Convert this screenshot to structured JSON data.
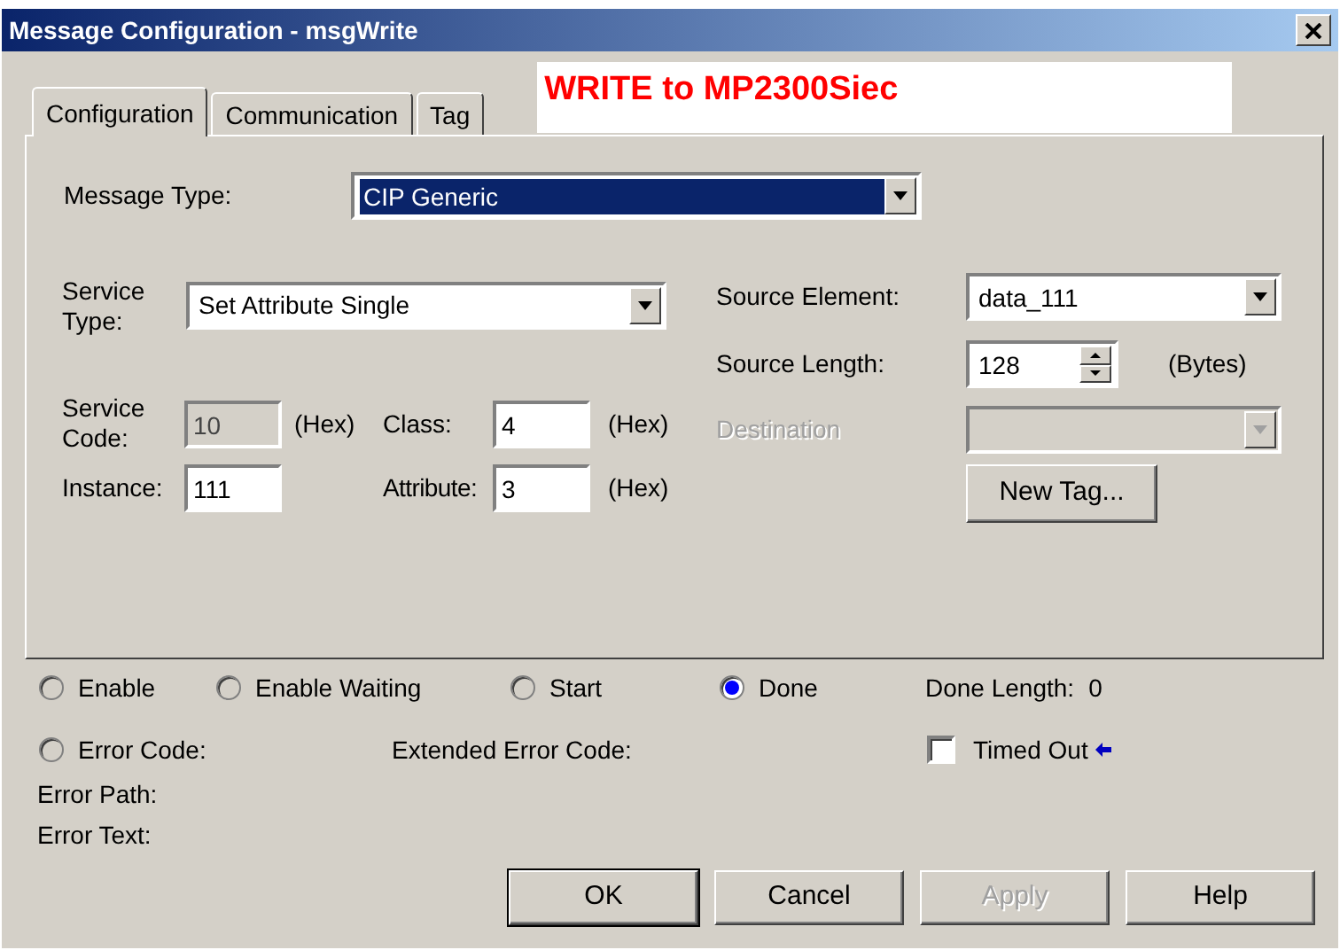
{
  "window": {
    "title": "Message Configuration - msgWrite"
  },
  "tabs": [
    {
      "label": "Configuration",
      "selected": true
    },
    {
      "label": "Communication",
      "selected": false
    },
    {
      "label": "Tag",
      "selected": false
    }
  ],
  "banner": "WRITE to MP2300Siec",
  "message_type": {
    "label": "Message Type:",
    "value": "CIP Generic"
  },
  "service_type": {
    "label": "Service Type:",
    "value": "Set Attribute Single"
  },
  "service_code": {
    "label": "Service Code:",
    "value": "10",
    "unit": "(Hex)",
    "disabled": true
  },
  "class": {
    "label": "Class:",
    "value": "4",
    "unit": "(Hex)"
  },
  "instance": {
    "label": "Instance:",
    "value": "111"
  },
  "attribute": {
    "label": "Attribute:",
    "value": "3",
    "unit": "(Hex)"
  },
  "source_element": {
    "label": "Source Element:",
    "value": "data_111"
  },
  "source_length": {
    "label": "Source Length:",
    "value": "128",
    "unit": "(Bytes)"
  },
  "destination": {
    "label": "Destination",
    "disabled": true
  },
  "new_tag_button": "New Tag...",
  "status_radios": [
    {
      "label": "Enable",
      "selected": false
    },
    {
      "label": "Enable Waiting",
      "selected": false
    },
    {
      "label": "Start",
      "selected": false
    },
    {
      "label": "Done",
      "selected": true
    }
  ],
  "done_length": {
    "label": "Done Length:",
    "value": "0"
  },
  "error_code": {
    "label": "Error Code:",
    "selected": false
  },
  "extended_error_code": "Extended Error Code:",
  "timed_out": {
    "label": "Timed Out",
    "checked": false
  },
  "error_path": "Error Path:",
  "error_text": "Error Text:",
  "buttons": [
    {
      "label": "OK",
      "disabled": false,
      "default": true
    },
    {
      "label": "Cancel",
      "disabled": false,
      "default": false
    },
    {
      "label": "Apply",
      "disabled": true,
      "default": false
    },
    {
      "label": "Help",
      "disabled": false,
      "default": false
    }
  ]
}
